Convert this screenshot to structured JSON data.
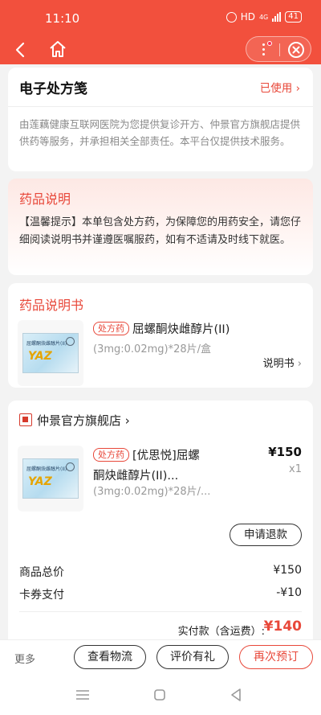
{
  "status": {
    "time": "11:10",
    "network": "HD",
    "signal": "4G",
    "battery": "41"
  },
  "nav": {
    "back_icon": "back-arrow-icon",
    "home_icon": "home-icon",
    "more_icon": "more-dots-icon",
    "close_icon": "close-circle-icon",
    "accent": "#f2503d"
  },
  "prescription": {
    "title": "电子处方笺",
    "status": "已使用",
    "description": "由莲藕健康互联网医院为您提供复诊开方、仲景官方旗舰店提供供药等服务，并承担相关全部责任。本平台仅提供技术服务。"
  },
  "drug_notice": {
    "title": "药品说明",
    "tip": "【温馨提示】本单包含处方药，为保障您的用药安全，请您仔细阅读说明书并谨遵医嘱服药，如有不适请及时线下就医。"
  },
  "leaflet": {
    "title": "药品说明书",
    "tag": "处方药",
    "name": "屈螺酮炔雌醇片(II)",
    "spec": "(3mg:0.02mg)*28片/盒",
    "link": "说明书",
    "box_label": "屈螺酮炔雌醇片(II)",
    "box_logo": "YAZ"
  },
  "store": {
    "name": "仲景官方旗舰店",
    "item": {
      "tag": "处方药",
      "name_line1": "[优思悦]屈螺",
      "name_line2": "酮炔雌醇片(II)...",
      "spec": "(3mg:0.02mg)*28片/...",
      "price": "¥150",
      "qty": "x1",
      "box_label": "屈螺酮炔雌醇片(II)",
      "box_logo": "YAZ"
    },
    "refund_button": "申请退款",
    "total_goods_label": "商品总价",
    "total_goods_value": "¥150",
    "coupon_label": "卡券支付",
    "coupon_value": "-¥10",
    "paid_label": "实付款（含运费）:",
    "paid_value": "¥140"
  },
  "bottom": {
    "more": "更多",
    "logistics": "查看物流",
    "review": "评价有礼",
    "reorder": "再次预订"
  }
}
